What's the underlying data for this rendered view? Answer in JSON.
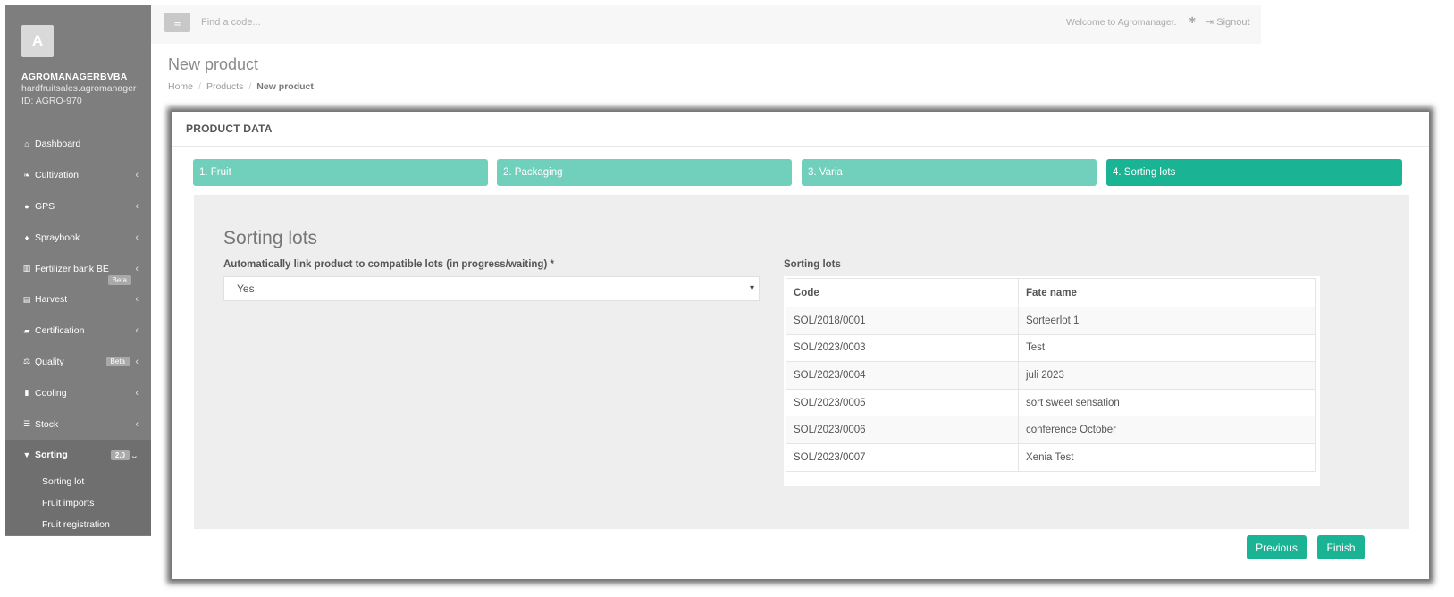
{
  "account": {
    "avatar_letter": "A",
    "name": "AGROMANAGERBVBA",
    "domain": "hardfruitsales.agromanager",
    "id_label": "ID: AGRO-970"
  },
  "nav": {
    "dashboard": "Dashboard",
    "cultivation": "Cultivation",
    "gps": "GPS",
    "spraybook": "Spraybook",
    "fertilizer": "Fertilizer bank BE",
    "fertilizer_badge": "Beta",
    "harvest": "Harvest",
    "certification": "Certification",
    "quality": "Quality",
    "quality_badge": "Beta",
    "cooling": "Cooling",
    "stock": "Stock",
    "sorting": "Sorting",
    "sorting_badge": "2.0",
    "sorting_sub": [
      "Sorting lot",
      "Fruit imports",
      "Fruit registration"
    ]
  },
  "topbar": {
    "search_placeholder": "Find a code...",
    "welcome": "Welcome to Agromanager.",
    "signout": "Signout"
  },
  "page": {
    "title": "New product",
    "breadcrumb": [
      "Home",
      "Products",
      "New product"
    ]
  },
  "panel": {
    "title": "PRODUCT DATA",
    "steps": [
      "1. Fruit",
      "2. Packaging",
      "3. Varia",
      "4. Sorting lots"
    ],
    "section_title": "Sorting lots",
    "auto_link_label": "Automatically link product to compatible lots (in progress/waiting) *",
    "auto_link_value": "Yes",
    "lots_label": "Sorting lots",
    "table": {
      "headers": [
        "Code",
        "Fate name"
      ],
      "rows": [
        [
          "SOL/2018/0001",
          "Sorteerlot 1"
        ],
        [
          "SOL/2023/0003",
          "Test"
        ],
        [
          "SOL/2023/0004",
          "juli 2023"
        ],
        [
          "SOL/2023/0005",
          "sort sweet sensation"
        ],
        [
          "SOL/2023/0006",
          "conference October"
        ],
        [
          "SOL/2023/0007",
          "Xenia Test"
        ]
      ]
    },
    "previous": "Previous",
    "finish": "Finish"
  },
  "icons": {
    "menu": "hamburger-icon",
    "bug": "bug-icon",
    "signout": "signout-icon"
  },
  "colors": {
    "accent": "#1ab394",
    "step_inactive": "#70d0bc",
    "sidebar": "#7e7e7e"
  }
}
